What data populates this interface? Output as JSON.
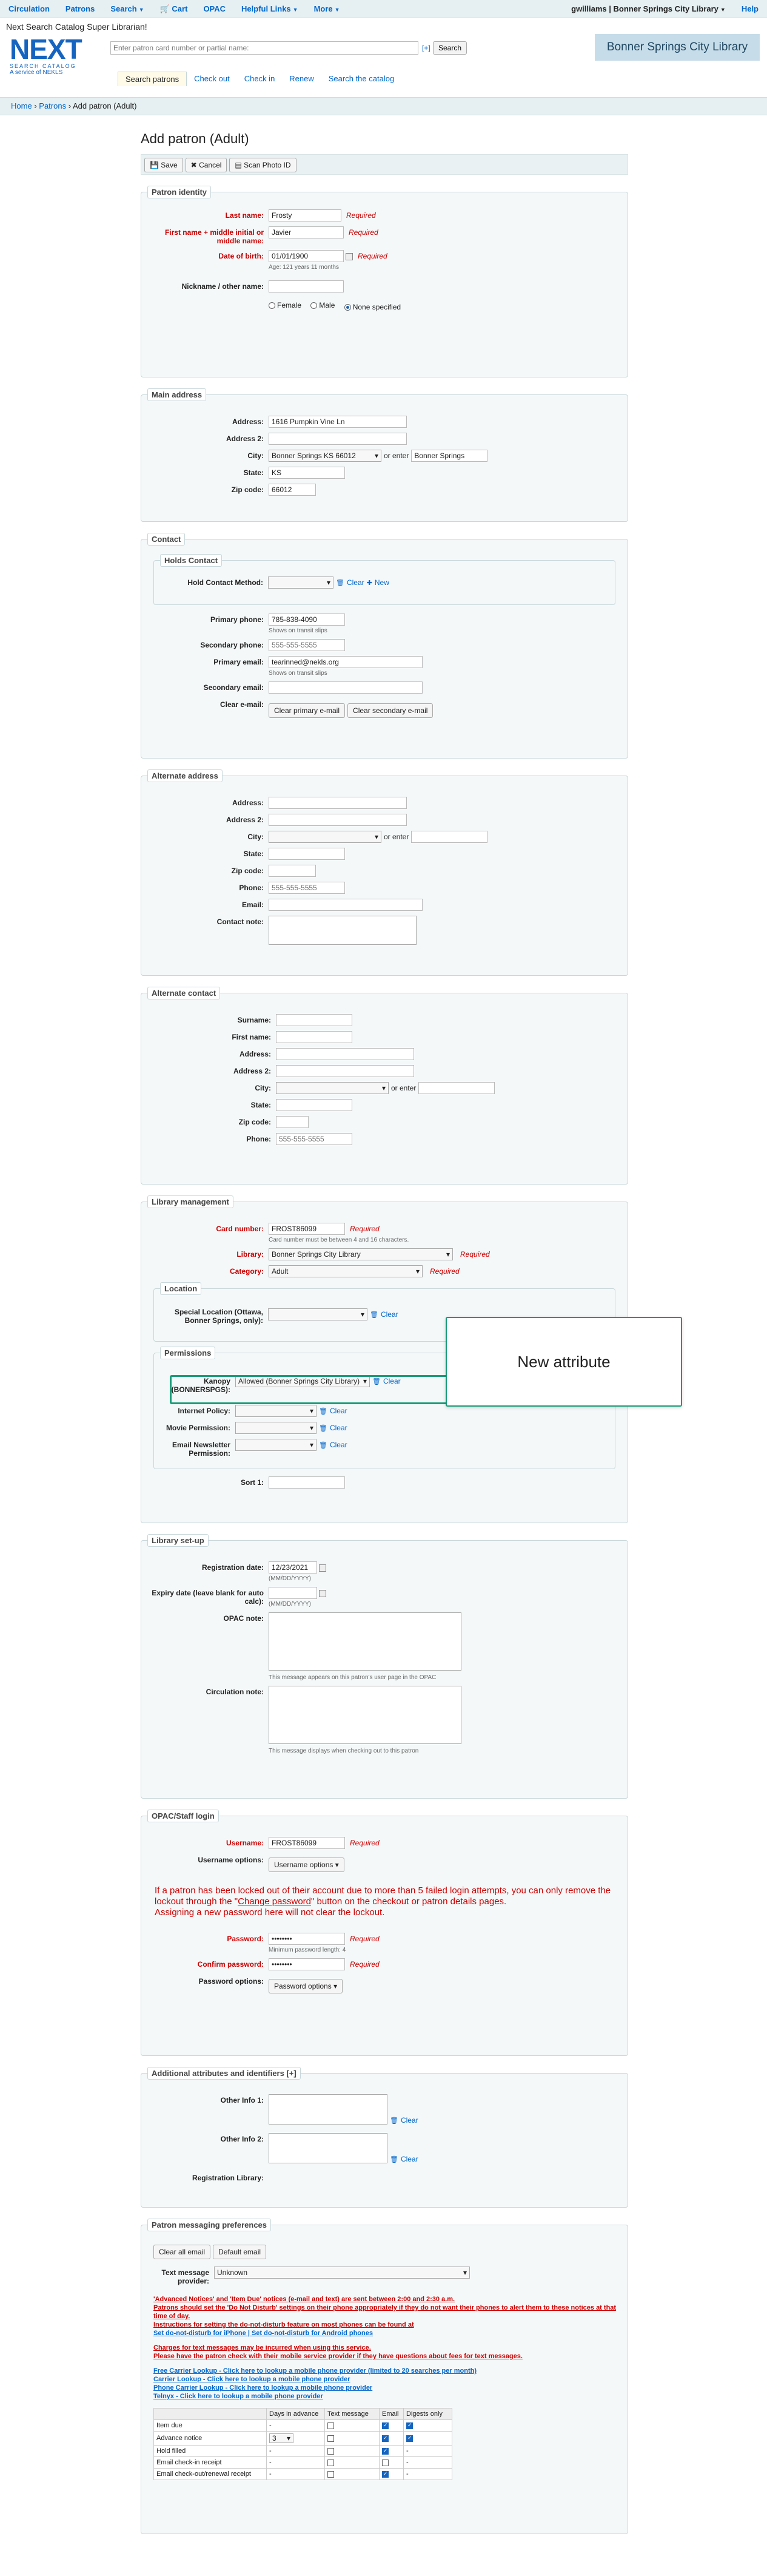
{
  "nav": {
    "items": [
      "Circulation",
      "Patrons",
      "Search",
      "Cart",
      "OPAC",
      "Helpful Links",
      "More"
    ],
    "user": "gwilliams",
    "library": "Bonner Springs City Library",
    "help": "Help"
  },
  "header": {
    "tagline": "Next Search Catalog Super Librarian!",
    "logo_text": "NEXT",
    "logo_sub": "SEARCH CATALOG",
    "logo_service": "A service of NEKLS",
    "search_placeholder": "Enter patron card number or partial name:",
    "search_plus": "[+]",
    "search_button": "Search",
    "tabs": [
      "Search patrons",
      "Check out",
      "Check in",
      "Renew",
      "Search the catalog"
    ],
    "library_badge": "Bonner Springs City Library"
  },
  "breadcrumb": {
    "home": "Home",
    "sep": "›",
    "patrons": "Patrons",
    "current": "Add patron (Adult)"
  },
  "page": {
    "title": "Add patron (Adult)",
    "save": "Save",
    "cancel": "Cancel",
    "scan": "Scan Photo ID"
  },
  "identity": {
    "legend": "Patron identity",
    "last_name_label": "Last name:",
    "last_name": "Frosty",
    "first_name_label": "First name + middle initial or middle name:",
    "first_name": "Javier",
    "dob_label": "Date of birth:",
    "dob": "01/01/1900",
    "dob_hint": "Age: 121 years 11 months",
    "nickname_label": "Nickname / other name:",
    "female": "Female",
    "male": "Male",
    "none": "None specified",
    "required": "Required"
  },
  "main_address": {
    "legend": "Main address",
    "address_label": "Address:",
    "address": "1616 Pumpkin Vine Ln",
    "address2_label": "Address 2:",
    "city_label": "City:",
    "city_select": "Bonner Springs KS 66012",
    "or_enter": "or enter",
    "city_text": "Bonner Springs",
    "state_label": "State:",
    "state": "KS",
    "zip_label": "Zip code:",
    "zip": "66012"
  },
  "contact": {
    "legend": "Contact",
    "holds_legend": "Holds Contact",
    "hold_method_label": "Hold Contact Method:",
    "clear": "Clear",
    "new": "New",
    "primary_phone_label": "Primary phone:",
    "primary_phone": "785-838-4090",
    "shows_slips": "Shows on transit slips",
    "secondary_phone_label": "Secondary phone:",
    "phone_ph": "555-555-5555",
    "primary_email_label": "Primary email:",
    "primary_email": "tearinned@nekls.org",
    "secondary_email_label": "Secondary email:",
    "clear_email_label": "Clear e-mail:",
    "clear_primary": "Clear primary e-mail",
    "clear_secondary": "Clear secondary e-mail"
  },
  "alt_address": {
    "legend": "Alternate address",
    "address_label": "Address:",
    "address2_label": "Address 2:",
    "city_label": "City:",
    "or_enter": "or enter",
    "state_label": "State:",
    "zip_label": "Zip code:",
    "phone_label": "Phone:",
    "phone_ph": "555-555-5555",
    "email_label": "Email:",
    "note_label": "Contact note:"
  },
  "alt_contact": {
    "legend": "Alternate contact",
    "surname_label": "Surname:",
    "first_label": "First name:",
    "address_label": "Address:",
    "address2_label": "Address 2:",
    "city_label": "City:",
    "or_enter": "or enter",
    "state_label": "State:",
    "zip_label": "Zip code:",
    "phone_label": "Phone:",
    "phone_ph": "555-555-5555"
  },
  "library_mgmt": {
    "legend": "Library management",
    "card_label": "Card number:",
    "card": "FROST86099",
    "card_hint": "Card number must be between 4 and 16 characters.",
    "library_label": "Library:",
    "library": "Bonner Springs City Library",
    "category_label": "Category:",
    "category": "Adult",
    "required": "Required",
    "location_legend": "Location",
    "special_loc_label": "Special Location (Ottawa, Bonner Springs, only):",
    "clear": "Clear",
    "permissions_legend": "Permissions",
    "kanopy_label": "Kanopy (BONNERSPGS):",
    "kanopy": "Allowed (Bonner Springs City Library)",
    "internet_label": "Internet Policy:",
    "movie_label": "Movie Permission:",
    "newsletter_label": "Email Newsletter Permission:",
    "sort1_label": "Sort 1:"
  },
  "callout": {
    "text": "New attribute"
  },
  "library_setup": {
    "legend": "Library set-up",
    "reg_label": "Registration date:",
    "reg": "12/23/2021",
    "date_hint": "(MM/DD/YYYY)",
    "expiry_label": "Expiry date (leave blank for auto calc):",
    "opac_note_label": "OPAC note:",
    "opac_hint": "This message appears on this patron's user page in the OPAC",
    "circ_note_label": "Circulation note:",
    "circ_hint": "This message displays when checking out to this patron"
  },
  "login": {
    "legend": "OPAC/Staff login",
    "username_label": "Username:",
    "username": "FROST86099",
    "required": "Required",
    "username_options_label": "Username options:",
    "username_options": "Username options",
    "warn1": "If a patron has been locked out of their account due to more than 5 failed login attempts, you can only remove the lockout through the \"",
    "warn_link": "Change password",
    "warn2": "\" button on the checkout or patron details pages.",
    "warn3": "Assigning a new password here will not clear the lockout.",
    "password_label": "Password:",
    "password": "••••••••",
    "min_len": "Minimum password length: 4",
    "confirm_label": "Confirm password:",
    "password_options_label": "Password options:",
    "password_options": "Password options"
  },
  "attributes": {
    "legend": "Additional attributes and identifiers [+]",
    "other1_label": "Other Info 1:",
    "other2_label": "Other Info 2:",
    "reg_lib_label": "Registration Library:",
    "clear": "Clear"
  },
  "messaging": {
    "legend": "Patron messaging preferences",
    "clear_all": "Clear all email",
    "default_email": "Default email",
    "provider_label": "Text message provider:",
    "provider": "Unknown",
    "lines_red": [
      "'Advanced Notices' and 'Item Due' notices (e-mail and text) are sent between 2:00 and 2:30 a.m.",
      "Patrons should set the 'Do Not Disturb' settings on their phone appropriately if they do not want their phones to alert them to these notices at that time of day.",
      "Instructions for setting the do-not-disturb feature on most phones can be found at"
    ],
    "line_dnd": "Set do-not-disturb for iPhone | Set do-not-disturb for Android phones",
    "lines_red2": [
      "Charges for text messages may be incurred when using this service.",
      "Please have the patron check with their mobile service provider if they have questions about fees for text messages."
    ],
    "lines_blue": [
      "Free Carrier Lookup - Click here to lookup a mobile phone provider (limited to 20 searches per month)",
      "Carrier Lookup - Click here to lookup a mobile phone provider",
      "Phone Carrier Lookup - Click here to lookup a mobile phone provider",
      "Telnyx - Click here to lookup a mobile phone provider"
    ],
    "table_headers": [
      "",
      "Days in advance",
      "Text message",
      "Email",
      "Digests only"
    ],
    "rows": [
      {
        "name": "Item due",
        "days": "-",
        "text": false,
        "email": true,
        "digest": true
      },
      {
        "name": "Advance notice",
        "days": "3",
        "text": false,
        "email": true,
        "digest": true
      },
      {
        "name": "Hold filled",
        "days": "-",
        "text": false,
        "email": true,
        "digest": "-"
      },
      {
        "name": "Email check-in receipt",
        "days": "-",
        "text": false,
        "email": false,
        "digest": "-"
      },
      {
        "name": "Email check-out/renewal receipt",
        "days": "-",
        "text": false,
        "email": true,
        "digest": "-"
      }
    ]
  }
}
